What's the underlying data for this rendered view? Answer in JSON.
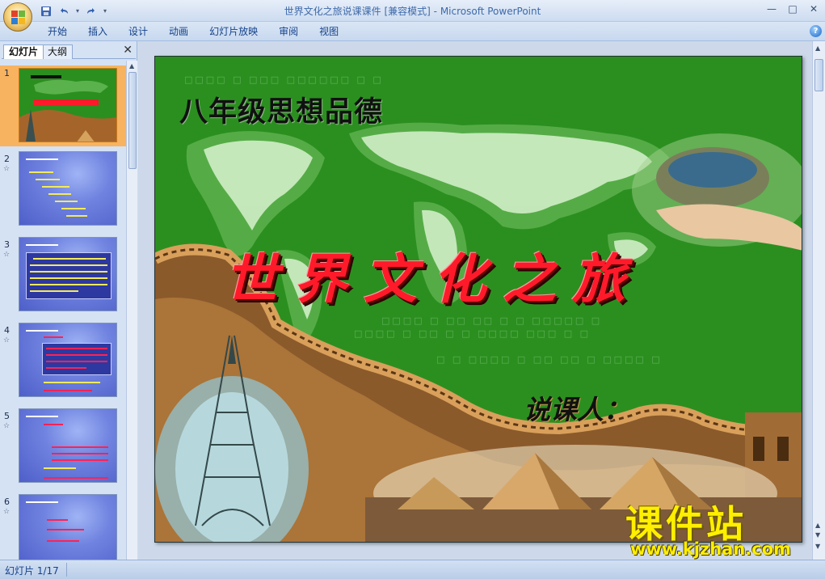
{
  "window": {
    "title_doc": "世界文化之旅说课课件 [兼容模式]",
    "title_sep": " - ",
    "title_app": "Microsoft PowerPoint",
    "controls": {
      "minimize": "—",
      "maximize": "□",
      "close": "✕"
    }
  },
  "quick_access": {
    "save_icon": "💾",
    "undo_icon": "↶",
    "dropdown": "▾",
    "redo_icon": "↷",
    "customize": "▾"
  },
  "ribbon": {
    "tabs": [
      "开始",
      "插入",
      "设计",
      "动画",
      "幻灯片放映",
      "审阅",
      "视图"
    ],
    "help": "?"
  },
  "pane": {
    "tab_slides": "幻灯片",
    "tab_outline": "大纲",
    "close": "✕",
    "thumbnails": [
      {
        "num": "1"
      },
      {
        "num": "2"
      },
      {
        "num": "3"
      },
      {
        "num": "4"
      },
      {
        "num": "5"
      },
      {
        "num": "6"
      }
    ]
  },
  "slide": {
    "subtitle": "八年级思想品德",
    "title": "世界文化之旅",
    "speaker": "说课人："
  },
  "status": {
    "slide_indicator": "幻灯片 1/17"
  },
  "watermark": {
    "title": "课件站",
    "url": "www.kjzhan.com"
  },
  "colors": {
    "slide_background": "#2b8f1f",
    "title_red": "#ff1a2a",
    "watermark_yellow": "#ffef00"
  }
}
